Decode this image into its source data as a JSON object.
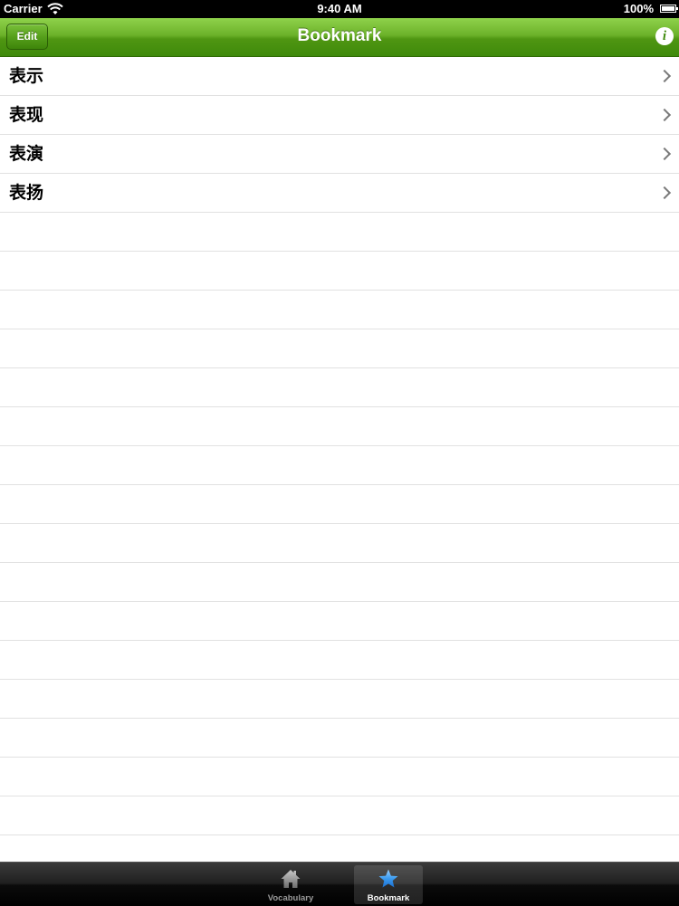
{
  "status_bar": {
    "carrier": "Carrier",
    "time": "9:40 AM",
    "battery": "100%"
  },
  "nav_bar": {
    "title": "Bookmark",
    "edit_label": "Edit",
    "info_icon": "info-icon"
  },
  "bookmarks": [
    {
      "label": "表示"
    },
    {
      "label": "表现"
    },
    {
      "label": "表演"
    },
    {
      "label": "表扬"
    }
  ],
  "tab_bar": {
    "tabs": [
      {
        "label": "Vocabulary",
        "icon": "home-icon",
        "selected": false
      },
      {
        "label": "Bookmark",
        "icon": "star-icon",
        "selected": true
      }
    ]
  },
  "colors": {
    "nav_green": "#5aa01e",
    "selected_tab_icon": "#3b9cf0"
  }
}
